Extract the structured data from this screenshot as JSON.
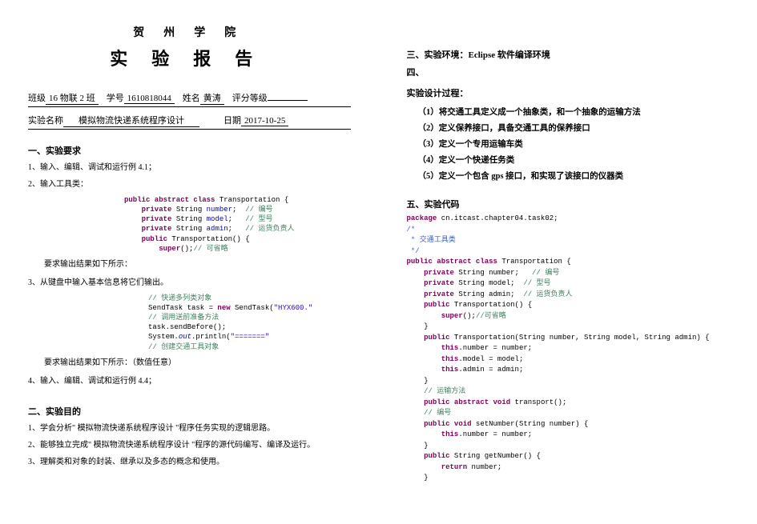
{
  "header": {
    "school": "贺州学院",
    "title": "实验报告"
  },
  "info": {
    "class_label": "班级",
    "class_value": "16 物联 2 班",
    "student_no_label": "学号",
    "student_no_value": "1610818044",
    "name_label": "姓名",
    "name_value": "黄涛",
    "grade_label": "评分等级",
    "grade_value": "",
    "exp_name_label": "实验名称",
    "exp_name_value": "模拟物流快递系统程序设计",
    "date_label": "日期",
    "date_value": "2017-10-25"
  },
  "sec1": {
    "head": "一、实验要求",
    "line1": "1、输入、编辑、调试和运行例 4.1；",
    "line2": "2、输入工具类：",
    "out_label1": "要求输出结果如下所示：",
    "line3": "3、从键盘中输入基本信息将它们输出。",
    "out_label2": "要求输出结果如下所示：（数值任意）",
    "line4": "4、输入、编辑、调试和运行例 4.4；"
  },
  "sec2": {
    "head": "二、实验目的",
    "line1": "1、学会分析\" 模拟物流快递系统程序设计 \"程序任务实现的逻辑思路。",
    "line2": "2、能够独立完成\" 模拟物流快递系统程序设计 \"程序的源代码编写、编译及运行。",
    "line3": "3、理解类和对象的封装、继承以及多态的概念和使用。"
  },
  "code1": {
    "l1a": "public abstract class",
    "l1b": " Transportation {",
    "l2a": "private",
    "l2b": " String ",
    "l2c": "number",
    "l2d": ";  ",
    "l2e": "// 编号",
    "l3a": "private",
    "l3b": " String ",
    "l3c": "model",
    "l3d": ";   ",
    "l3e": "// 型号",
    "l4a": "private",
    "l4b": " String ",
    "l4c": "admin",
    "l4d": ";   ",
    "l4e": "// 运货负责人",
    "l5a": "public",
    "l5b": " Transportation() {",
    "l6a": "super",
    "l6b": "();",
    "l6c": "// 可省略"
  },
  "code2": {
    "l1": "// 快递多列类对象",
    "l2a": "SendTask task = ",
    "l2b": "new",
    "l2c": " SendTask(",
    "l2d": "\"HYX600.\"",
    "l2e": "",
    "l3": "// 调用送前准备方法",
    "l4": "task.sendBefore();",
    "l5a": "System.",
    "l5b": "out",
    "l5c": ".println(",
    "l5d": "\"=======\"",
    "l5e": "",
    "l6": "// 创建交通工具对象"
  },
  "right": {
    "sec3": "三、实验环境：Eclipse 软件编译环境",
    "sec4": "四、",
    "design_head": "实验设计过程：",
    "d1": "（1）将交通工具定义成一个抽象类，和一个抽象的运输方法",
    "d2": "（2）定义保养接口，具备交通工具的保养接口",
    "d3": "（3）定义一个专用运输车类",
    "d4": "（4）定义一个快递任务类",
    "d5": "（5）定义一个包含 gps 接口，和实现了该接口的仪器类",
    "sec5": "五、实验代码"
  },
  "code3": {
    "pkg_a": "package",
    "pkg_b": " cn.itcast.chapter04.task02;",
    "c1": "/*",
    "c2": " * 交通工具类",
    "c3": " */",
    "cls_a": "public abstract class",
    "cls_b": " Transportation {",
    "f1a": "private",
    "f1b": " String number;   ",
    "f1c": "// 编号",
    "f2a": "private",
    "f2b": " String model;  ",
    "f2c": "// 型号",
    "f3a": "private",
    "f3b": " String admin;  ",
    "f3c": "// 运货负责人",
    "m1a": "public",
    "m1b": " Transportation() {",
    "m1c": "super",
    "m1d": "();",
    "m1e": "//可省略",
    "m2a": "public",
    "m2b": " Transportation(String number, String model, String admin) {",
    "m2c": "this",
    "m2d": ".number = number;",
    "m2e": "this",
    "m2f": ".model = model;",
    "m2g": "this",
    "m2h": ".admin = admin;",
    "c4": "// 运输方法",
    "m3a": "public abstract void",
    "m3b": " transport();",
    "c5": "// 编号",
    "m4a": "public void",
    "m4b": " setNumber(String number) {",
    "m4c": "this",
    "m4d": ".number = number;",
    "m5a": "public",
    "m5b": " String getNumber() {",
    "m5c": "return",
    "m5d": " number;"
  }
}
